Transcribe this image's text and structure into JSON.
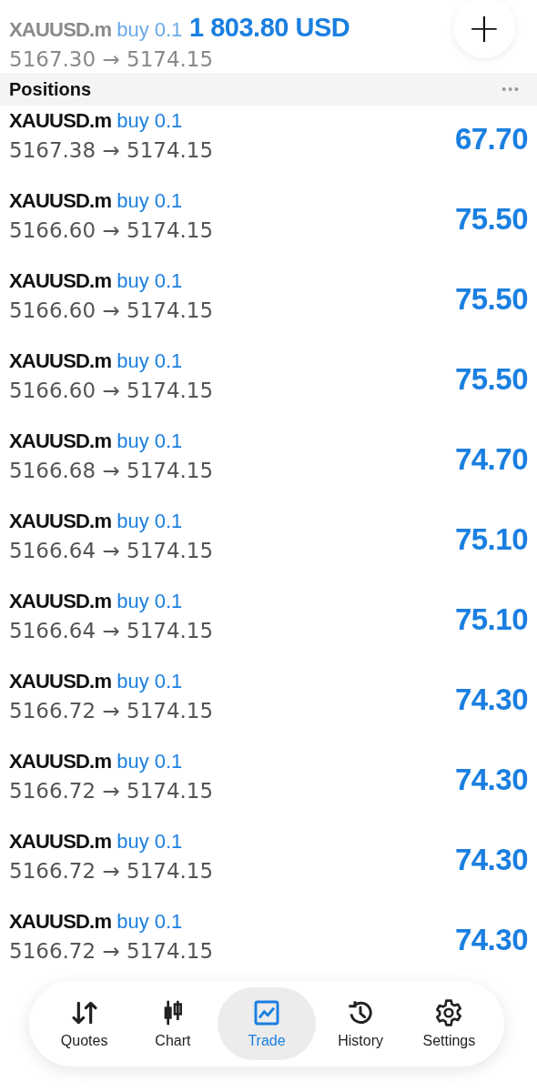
{
  "header": {
    "total": "1 803.80 USD",
    "add_button": "+"
  },
  "faded_row": {
    "symbol": "XAUUSD.m",
    "side": "buy 0.1",
    "prices": "5167.30 → 5174.15"
  },
  "section": {
    "title": "Positions",
    "menu": "•••"
  },
  "positions": [
    {
      "symbol": "XAUUSD.m",
      "side": "buy 0.1",
      "prices": "5167.38 → 5174.15",
      "profit": "67.70"
    },
    {
      "symbol": "XAUUSD.m",
      "side": "buy 0.1",
      "prices": "5166.60 → 5174.15",
      "profit": "75.50"
    },
    {
      "symbol": "XAUUSD.m",
      "side": "buy 0.1",
      "prices": "5166.60 → 5174.15",
      "profit": "75.50"
    },
    {
      "symbol": "XAUUSD.m",
      "side": "buy 0.1",
      "prices": "5166.60 → 5174.15",
      "profit": "75.50"
    },
    {
      "symbol": "XAUUSD.m",
      "side": "buy 0.1",
      "prices": "5166.68 → 5174.15",
      "profit": "74.70"
    },
    {
      "symbol": "XAUUSD.m",
      "side": "buy 0.1",
      "prices": "5166.64 → 5174.15",
      "profit": "75.10"
    },
    {
      "symbol": "XAUUSD.m",
      "side": "buy 0.1",
      "prices": "5166.64 → 5174.15",
      "profit": "75.10"
    },
    {
      "symbol": "XAUUSD.m",
      "side": "buy 0.1",
      "prices": "5166.72 → 5174.15",
      "profit": "74.30"
    },
    {
      "symbol": "XAUUSD.m",
      "side": "buy 0.1",
      "prices": "5166.72 → 5174.15",
      "profit": "74.30"
    },
    {
      "symbol": "XAUUSD.m",
      "side": "buy 0.1",
      "prices": "5166.72 → 5174.15",
      "profit": "74.30"
    },
    {
      "symbol": "XAUUSD.m",
      "side": "buy 0.1",
      "prices": "5166.72 → 5174.15",
      "profit": "74.30"
    }
  ],
  "nav": [
    {
      "label": "Quotes",
      "kind": "quotes",
      "selected": false
    },
    {
      "label": "Chart",
      "kind": "chart",
      "selected": false
    },
    {
      "label": "Trade",
      "kind": "trade",
      "selected": true
    },
    {
      "label": "History",
      "kind": "history",
      "selected": false
    },
    {
      "label": "Settings",
      "kind": "settings",
      "selected": false
    }
  ]
}
